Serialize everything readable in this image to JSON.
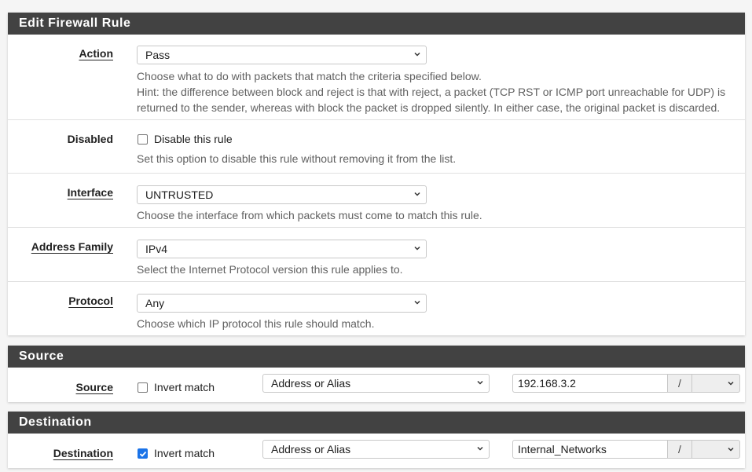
{
  "edit_panel": {
    "title": "Edit Firewall Rule",
    "action": {
      "label": "Action",
      "value": "Pass",
      "help_lines": [
        "Choose what to do with packets that match the criteria specified below.",
        "Hint: the difference between block and reject is that with reject, a packet (TCP RST or ICMP port unreachable for UDP) is",
        "returned to the sender, whereas with block the packet is dropped silently. In either case, the original packet is discarded."
      ]
    },
    "disabled": {
      "label": "Disabled",
      "checkbox_label": "Disable this rule",
      "checked": false,
      "help": "Set this option to disable this rule without removing it from the list."
    },
    "interface": {
      "label": "Interface",
      "value": "UNTRUSTED",
      "help": "Choose the interface from which packets must come to match this rule."
    },
    "address_family": {
      "label": "Address Family",
      "value": "IPv4",
      "help": "Select the Internet Protocol version this rule applies to."
    },
    "protocol": {
      "label": "Protocol",
      "value": "Any",
      "help": "Choose which IP protocol this rule should match."
    }
  },
  "source_panel": {
    "title": "Source",
    "label": "Source",
    "invert_label": "Invert match",
    "invert_checked": false,
    "type": "Address or Alias",
    "address": "192.168.3.2",
    "slash": "/",
    "mask": ""
  },
  "destination_panel": {
    "title": "Destination",
    "label": "Destination",
    "invert_label": "Invert match",
    "invert_checked": true,
    "type": "Address or Alias",
    "address": "Internal_Networks",
    "slash": "/",
    "mask": ""
  },
  "colors": {
    "heading_bg": "#424242",
    "checkbox_checked": "#1a73e8",
    "help_text": "#616161"
  }
}
